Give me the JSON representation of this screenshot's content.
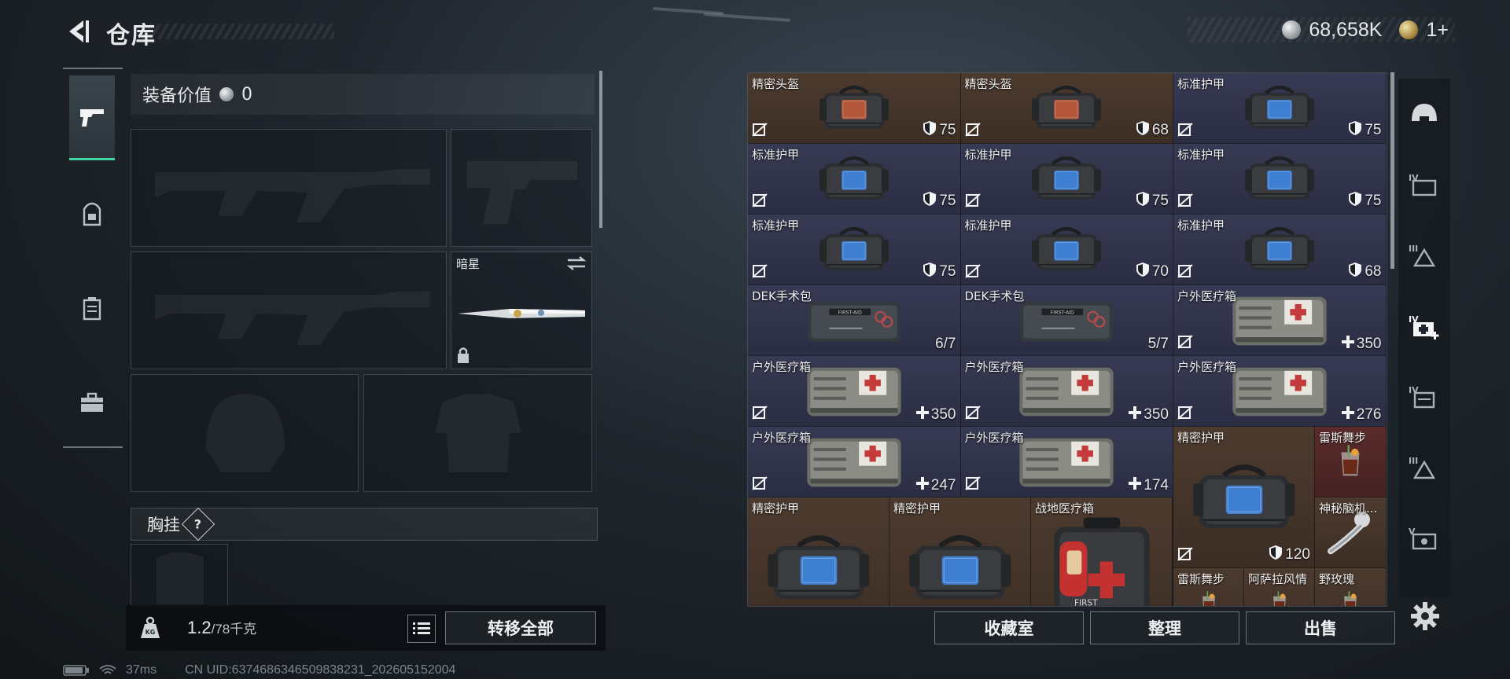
{
  "header": {
    "title": "仓库",
    "currency_silver": "68,658K",
    "currency_gold": "1+"
  },
  "left_nav": {
    "items": [
      "weapons-tab",
      "backpack-tab",
      "vest-tab",
      "toolbox-tab"
    ]
  },
  "equipment": {
    "value_label": "装备价值",
    "value": "0",
    "knife_name": "暗星",
    "chest_label": "胸挂",
    "help": "?"
  },
  "bottom": {
    "weight_current": "1.2",
    "weight_max": "/78千克",
    "kg_badge": "KG",
    "transfer_all": "转移全部",
    "collection": "收藏室",
    "organize": "整理",
    "sell": "出售"
  },
  "stash": {
    "items": [
      {
        "name": "精密头盔",
        "stat": "75",
        "stat_icon": "shield",
        "rarity": "brown",
        "art": "helmet-bag"
      },
      {
        "name": "精密头盔",
        "stat": "68",
        "stat_icon": "shield",
        "rarity": "brown",
        "art": "helmet-bag"
      },
      {
        "name": "标准护甲",
        "stat": "75",
        "stat_icon": "shield",
        "rarity": "purple",
        "art": "armor-bag"
      },
      {
        "name": "标准护甲",
        "stat": "75",
        "stat_icon": "shield",
        "rarity": "purple",
        "art": "armor-bag"
      },
      {
        "name": "标准护甲",
        "stat": "75",
        "stat_icon": "shield",
        "rarity": "purple",
        "art": "armor-bag"
      },
      {
        "name": "标准护甲",
        "stat": "75",
        "stat_icon": "shield",
        "rarity": "purple",
        "art": "armor-bag"
      },
      {
        "name": "标准护甲",
        "stat": "75",
        "stat_icon": "shield",
        "rarity": "purple",
        "art": "armor-bag"
      },
      {
        "name": "标准护甲",
        "stat": "70",
        "stat_icon": "shield",
        "rarity": "purple",
        "art": "armor-bag"
      },
      {
        "name": "标准护甲",
        "stat": "68",
        "stat_icon": "shield",
        "rarity": "purple",
        "art": "armor-bag"
      },
      {
        "name": "DEK手术包",
        "stat": "6/7",
        "stat_icon": "none",
        "rarity": "purple",
        "art": "surgery-kit"
      },
      {
        "name": "DEK手术包",
        "stat": "5/7",
        "stat_icon": "none",
        "rarity": "purple",
        "art": "surgery-kit"
      },
      {
        "name": "户外医疗箱",
        "stat": "350",
        "stat_icon": "plus",
        "rarity": "purple",
        "art": "medkit"
      },
      {
        "name": "户外医疗箱",
        "stat": "350",
        "stat_icon": "plus",
        "rarity": "purple",
        "art": "medkit"
      },
      {
        "name": "户外医疗箱",
        "stat": "350",
        "stat_icon": "plus",
        "rarity": "purple",
        "art": "medkit"
      },
      {
        "name": "户外医疗箱",
        "stat": "276",
        "stat_icon": "plus",
        "rarity": "purple",
        "art": "medkit"
      },
      {
        "name": "户外医疗箱",
        "stat": "247",
        "stat_icon": "plus",
        "rarity": "purple",
        "art": "medkit"
      },
      {
        "name": "户外医疗箱",
        "stat": "174",
        "stat_icon": "plus",
        "rarity": "purple",
        "art": "medkit"
      },
      {
        "name": "精密护甲",
        "stat": "120",
        "stat_icon": "shield",
        "rarity": "brown",
        "art": "armor-bag"
      },
      {
        "name": "雷斯舞步",
        "stat": "",
        "stat_icon": "none",
        "rarity": "red",
        "art": "drink"
      },
      {
        "name": "精密护甲",
        "stat": "",
        "stat_icon": "none",
        "rarity": "brown",
        "art": "armor-bag"
      },
      {
        "name": "精密护甲",
        "stat": "",
        "stat_icon": "none",
        "rarity": "brown",
        "art": "armor-bag"
      },
      {
        "name": "战地医疗箱",
        "stat": "",
        "stat_icon": "none",
        "rarity": "brown",
        "art": "field-medkit"
      },
      {
        "name": "神秘脑机...",
        "stat": "",
        "stat_icon": "none",
        "rarity": "brown",
        "art": "brain-device"
      },
      {
        "name": "雷斯舞步",
        "stat": "",
        "stat_icon": "none",
        "rarity": "brown",
        "art": "small-drink"
      },
      {
        "name": "阿萨拉风情",
        "stat": "",
        "stat_icon": "none",
        "rarity": "brown",
        "art": "small-drink"
      },
      {
        "name": "野玫瑰",
        "stat": "",
        "stat_icon": "none",
        "rarity": "brown",
        "art": "small-drink"
      }
    ]
  },
  "right_nav": {
    "items": [
      "helmet-category",
      "armor-iv-category",
      "armor-iii-category",
      "medical-iv-category",
      "rig-iv-category",
      "armor-iii-b-category",
      "device-v-category"
    ],
    "active": "medical-iv-category"
  },
  "status": {
    "ping": "37ms",
    "uid": "CN UID:6374686346509838231_202605152004"
  },
  "colors": {
    "accent": "#3fd6a0",
    "purple_rarity": "#373a53",
    "brown_rarity": "#4c3a2e",
    "red_rarity": "#5a2b2b"
  }
}
